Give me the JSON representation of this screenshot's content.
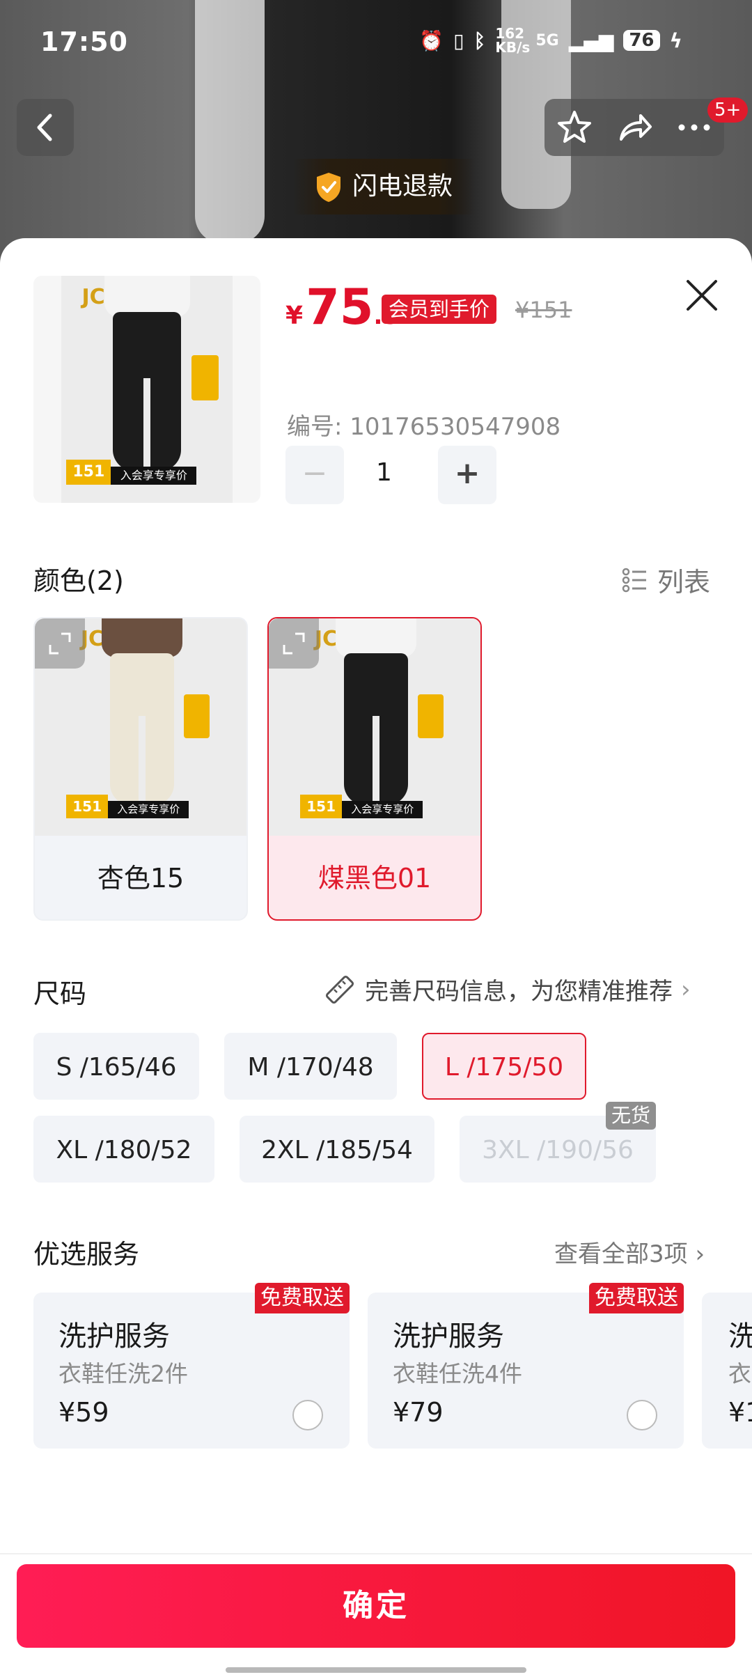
{
  "status_bar": {
    "time": "17:50",
    "net_speed": "162 KB/s",
    "network": "5G",
    "battery": "76"
  },
  "header": {
    "more_badge": "5+",
    "refund_label": "闪电退款"
  },
  "product": {
    "price_symbol": "¥",
    "price_integer": "75",
    "price_decimal": ".5",
    "member_tag": "会员到手价",
    "original_price": "¥151",
    "sku_label": "编号: 10176530547908",
    "quantity": "1",
    "qty_minus": "−",
    "qty_plus": "+",
    "thumb_tag_price": "151",
    "thumb_tag_vip": "入会享专享价"
  },
  "color_section": {
    "title": "颜色(2)",
    "list_toggle": "列表",
    "options": [
      {
        "label": "杏色15",
        "pants_color": "#ece6d6"
      },
      {
        "label": "煤黑色01",
        "pants_color": "#1c1c1c"
      }
    ]
  },
  "size_section": {
    "title": "尺码",
    "guide": "完善尺码信息，为您精准推荐",
    "guide_arrow": "›",
    "options": [
      {
        "label": "S /165/46"
      },
      {
        "label": "M /170/48"
      },
      {
        "label": "L /175/50"
      },
      {
        "label": "XL /180/52"
      },
      {
        "label": "2XL /185/54"
      },
      {
        "label": "3XL /190/56"
      }
    ],
    "out_of_stock": "无货"
  },
  "services": {
    "title": "优选服务",
    "see_all": "查看全部3项 ›",
    "items": [
      {
        "title": "洗护服务",
        "sub": "衣鞋任洗2件",
        "price": "¥59",
        "badge": "免费取送"
      },
      {
        "title": "洗护服务",
        "sub": "衣鞋任洗4件",
        "price": "¥79",
        "badge": "免费取送"
      },
      {
        "title": "洗",
        "sub": "衣",
        "price": "¥1",
        "badge": ""
      }
    ]
  },
  "footer": {
    "confirm_label": "确定"
  }
}
